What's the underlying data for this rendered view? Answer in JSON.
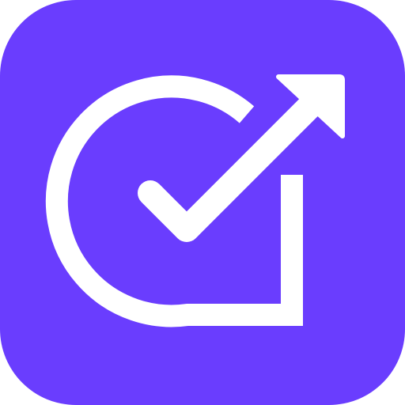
{
  "icon": {
    "name": "goal-progress-check",
    "background_color": "#6a3dfe",
    "glyph_color": "#ffffff"
  }
}
